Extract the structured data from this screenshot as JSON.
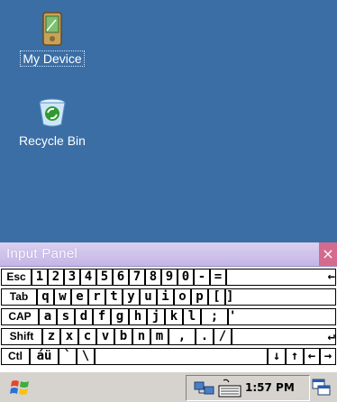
{
  "desktop": {
    "icons": [
      {
        "label": "My Device"
      },
      {
        "label": "Recycle Bin"
      }
    ]
  },
  "input_panel": {
    "title": "Input Panel",
    "close_glyph": "×",
    "keyboard": {
      "row1": [
        "Esc",
        "1",
        "2",
        "3",
        "4",
        "5",
        "6",
        "7",
        "8",
        "9",
        "0",
        "-",
        "=",
        "←"
      ],
      "row2": [
        "Tab",
        "q",
        "w",
        "e",
        "r",
        "t",
        "y",
        "u",
        "i",
        "o",
        "p",
        "[",
        "]"
      ],
      "row3": [
        "CAP",
        "a",
        "s",
        "d",
        "f",
        "g",
        "h",
        "j",
        "k",
        "l",
        ";",
        "'"
      ],
      "row4": [
        "Shift",
        "z",
        "x",
        "c",
        "v",
        "b",
        "n",
        "m",
        ",",
        ".",
        "/",
        "↵"
      ],
      "row5": [
        "Ctl",
        "áü",
        "`",
        "\\",
        "",
        "↓",
        "↑",
        "←",
        "→"
      ]
    }
  },
  "taskbar": {
    "clock": "1:57 PM",
    "icons": {
      "start": "windows-flag-icon",
      "network": "network-icon",
      "keyboard": "keyboard-icon",
      "switcher": "window-switch-icon"
    }
  },
  "colors": {
    "desktop": "#3a6ea5",
    "taskbar": "#d6d3ce",
    "panel_title": "#c4b6e6",
    "close": "#d56a8f"
  }
}
